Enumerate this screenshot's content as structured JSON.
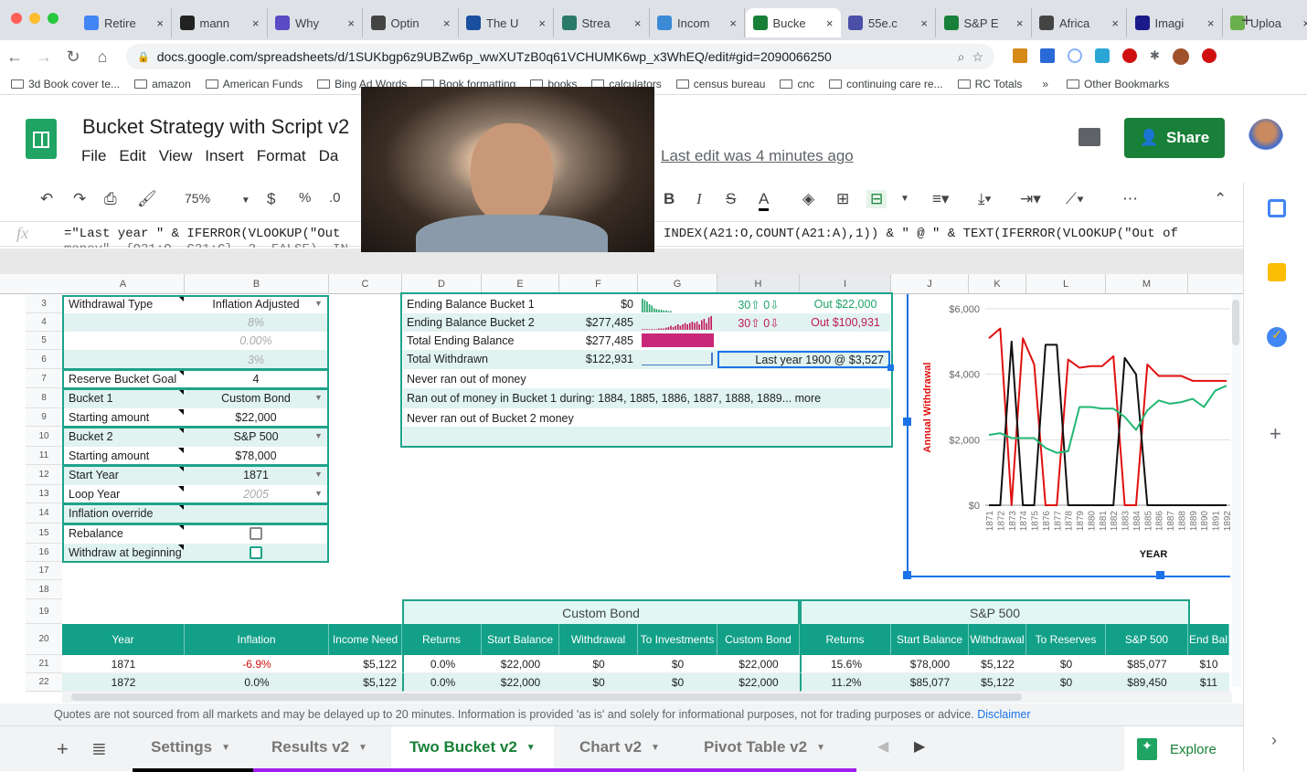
{
  "browser": {
    "tabs": [
      {
        "label": "Retire",
        "icon": "docs-icon",
        "color": "#4285f4"
      },
      {
        "label": "mann",
        "icon": "bank-icon",
        "color": "#222"
      },
      {
        "label": "Why",
        "icon": "podcast-icon",
        "color": "#5b4bc4"
      },
      {
        "label": "Optin",
        "icon": "globe-icon",
        "color": "#444"
      },
      {
        "label": "The U",
        "icon": "shield-icon",
        "color": "#1a4fa0"
      },
      {
        "label": "Strea",
        "icon": "streamyard-icon",
        "color": "#2a7a6a"
      },
      {
        "label": "Incom",
        "icon": "refresh-icon",
        "color": "#3a8ad6"
      },
      {
        "label": "Bucke",
        "icon": "sheets-icon",
        "color": "#188038",
        "active": true
      },
      {
        "label": "55e.c",
        "icon": "calendar-icon",
        "color": "#4b4fa8"
      },
      {
        "label": "S&P E",
        "icon": "sheets-icon",
        "color": "#188038"
      },
      {
        "label": "Africa",
        "icon": "dollar-icon",
        "color": "#444"
      },
      {
        "label": "Imagi",
        "icon": "notion-icon",
        "color": "#1a1a8a"
      },
      {
        "label": "Uploa",
        "icon": "play-icon",
        "color": "#6ab04c"
      }
    ],
    "url": "docs.google.com/spreadsheets/d/1SUKbgp6z9UBZw6p_wwXUTzB0q61VCHUMK6wp_x3WhEQ/edit#gid=2090066250",
    "bookmarks": [
      "3d Book cover te...",
      "amazon",
      "American Funds",
      "Bing Ad Words",
      "Book formatting",
      "books",
      "calculators",
      "census bureau",
      "cnc",
      "continuing care re...",
      "RC Totals"
    ],
    "other_bookmarks": "Other Bookmarks"
  },
  "doc": {
    "title": "Bucket Strategy with Script v2",
    "menus": [
      "File",
      "Edit",
      "View",
      "Insert",
      "Format",
      "Da"
    ],
    "last_edit": "Last edit was 4 minutes ago",
    "share": "Share"
  },
  "toolbar": {
    "zoom": "75%",
    "currency": "$",
    "percent": "%",
    "decimal": ".0"
  },
  "formula": {
    "part1": "=\"Last year \" & IFERROR(VLOOKUP(\"Out",
    "part2": "INDEX(A21:O,COUNT(A21:A),1)) & \" @ \" & TEXT(IFERROR(VLOOKUP(\"Out of",
    "part3": "money\", {O21:O, C21:C}, 2, FALSE), IN"
  },
  "columns": [
    "A",
    "B",
    "C",
    "D",
    "E",
    "F",
    "G",
    "H",
    "I",
    "J",
    "K",
    "L",
    "M"
  ],
  "rows": [
    "3",
    "4",
    "5",
    "6",
    "7",
    "8",
    "9",
    "10",
    "11",
    "12",
    "13",
    "14",
    "15",
    "16",
    "17",
    "18",
    "19",
    "20",
    "21",
    "22"
  ],
  "settings": [
    {
      "label": "Withdrawal Type",
      "value": "Inflation Adjusted",
      "dropdown": true
    },
    {
      "label": "",
      "value": "8%",
      "muted": true
    },
    {
      "label": "",
      "value": "0.00%",
      "muted": true
    },
    {
      "label": "",
      "value": "3%",
      "muted": true
    },
    {
      "label": "Reserve Bucket Goal",
      "value": "4"
    },
    {
      "label": "Bucket 1",
      "value": "Custom Bond",
      "dropdown": true
    },
    {
      "label": "Starting amount",
      "value": "$22,000"
    },
    {
      "label": "Bucket 2",
      "value": "S&P 500",
      "dropdown": true
    },
    {
      "label": "Starting amount",
      "value": "$78,000"
    },
    {
      "label": "Start Year",
      "value": "1871",
      "dropdown": true
    },
    {
      "label": "Loop Year",
      "value": "2005",
      "muted": true,
      "dropdown": true
    },
    {
      "label": "Inflation override",
      "value": ""
    },
    {
      "label": "Rebalance",
      "checkbox": false
    },
    {
      "label": "Withdraw at beginning",
      "checkbox": false
    }
  ],
  "results": [
    {
      "label": "Ending Balance Bucket 1",
      "value": "$0",
      "updown": "30⇧ 0⇩",
      "out": "Out $22,000",
      "color": "#1fa36a"
    },
    {
      "label": "Ending Balance Bucket 2",
      "value": "$277,485",
      "updown": "30⇧ 0⇩",
      "out": "Out $100,931",
      "color": "#c2185b"
    },
    {
      "label": "Total Ending Balance",
      "value": "$277,485"
    },
    {
      "label": "Total Withdrawn",
      "value": "$122,931",
      "note": "Last year 1900 @ $3,527"
    }
  ],
  "messages": [
    "Never ran out of money",
    "Ran out of money in Bucket 1 during: 1884, 1885, 1886, 1887, 1888, 1889... more",
    "Never ran out of Bucket 2 money"
  ],
  "chart_data": {
    "type": "line",
    "ylabel": "Annual Withdrawal",
    "xlabel": "YEAR",
    "ylim": [
      0,
      6000
    ],
    "yticks": [
      "$0",
      "$2,000",
      "$4,000",
      "$6,000"
    ],
    "grid": true,
    "x": [
      "1871",
      "1872",
      "1873",
      "1874",
      "1875",
      "1876",
      "1877",
      "1878",
      "1879",
      "1880",
      "1881",
      "1882",
      "1883",
      "1884",
      "1885",
      "1886",
      "1887",
      "1888",
      "1889",
      "1890",
      "1891",
      "1892"
    ],
    "series": [
      {
        "color": "#e01010",
        "values": [
          5100,
          5400,
          0,
          5100,
          4300,
          0,
          0,
          4450,
          4200,
          4250,
          4250,
          4550,
          0,
          0,
          4300,
          3950,
          3950,
          3950,
          3800,
          3800,
          3800,
          3800
        ]
      },
      {
        "color": "#111111",
        "values": [
          0,
          0,
          5000,
          0,
          0,
          4900,
          4900,
          0,
          0,
          0,
          0,
          0,
          4500,
          4000,
          0,
          0,
          0,
          0,
          0,
          0,
          0,
          0
        ]
      },
      {
        "color": "#22b873",
        "values": [
          2150,
          2200,
          2050,
          2050,
          2050,
          1750,
          1600,
          1650,
          3000,
          3000,
          2950,
          2950,
          2700,
          2300,
          2900,
          3200,
          3100,
          3150,
          3250,
          3000,
          3500,
          3650
        ]
      }
    ]
  },
  "table": {
    "group1": "Custom Bond",
    "group2": "S&P 500",
    "headers": [
      "Year",
      "Inflation",
      "Income Need",
      "Returns",
      "Start Balance",
      "Withdrawal",
      "To Investments",
      "Custom Bond",
      "Returns",
      "Start Balance",
      "Withdrawal",
      "To Reserves",
      "S&P 500",
      "End Bal"
    ],
    "rows": [
      [
        "1871",
        "-6.9%",
        "$5,122",
        "0.0%",
        "$22,000",
        "$0",
        "$0",
        "$22,000",
        "15.6%",
        "$78,000",
        "$5,122",
        "$0",
        "$85,077",
        "$10"
      ],
      [
        "1872",
        "0.0%",
        "$5,122",
        "0.0%",
        "$22,000",
        "$0",
        "$0",
        "$22,000",
        "11.2%",
        "$85,077",
        "$5,122",
        "$0",
        "$89,450",
        "$11"
      ]
    ],
    "negative_color": "#d01010"
  },
  "disclaimer": {
    "text": "Quotes are not sourced from all markets and may be delayed up to 20 minutes. Information is provided 'as is' and solely for informational purposes, not for trading purposes or advice.",
    "link": "Disclaimer"
  },
  "sheet_tabs": [
    {
      "label": "Settings"
    },
    {
      "label": "Results v2"
    },
    {
      "label": "Two Bucket v2",
      "active": true
    },
    {
      "label": "Chart v2"
    },
    {
      "label": "Pivot Table v2"
    }
  ],
  "explore": "Explore",
  "colors": {
    "accent": "#12a088",
    "brand": "#188038",
    "tint": "#e0f3f0"
  }
}
